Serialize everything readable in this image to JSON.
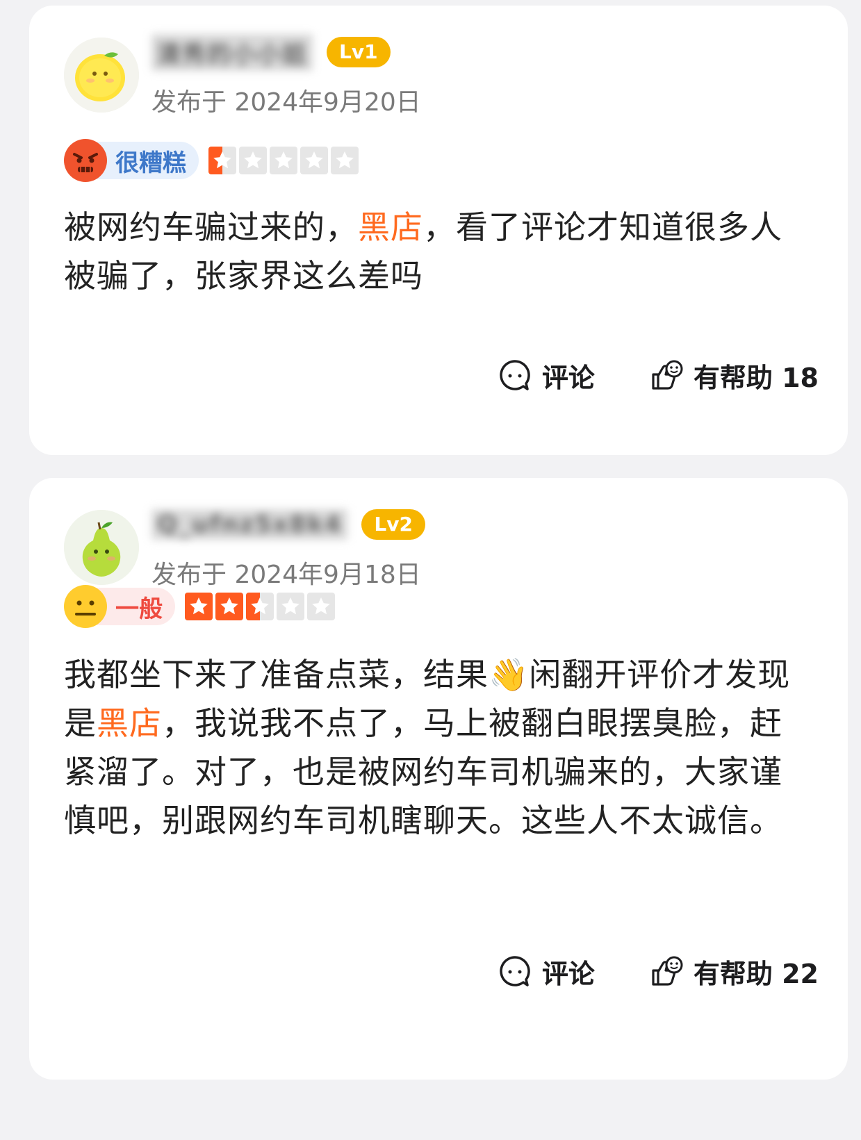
{
  "reviews": [
    {
      "username": "清秀的小小姐",
      "level": "Lv1",
      "avatar": "lemon-avatar",
      "date": "发布于 2024年9月20日",
      "rating_label": "很糟糕",
      "rating_face": "angry-face-icon",
      "stars": 0.5,
      "stars_max": 5,
      "text_parts": [
        "被网约车骗过来的，",
        "黑店",
        "，看了评论才知道很多人被骗了，张家界这么差吗"
      ],
      "comment_label": "评论",
      "helpful_label": "有帮助 18"
    },
    {
      "username": "Q_ufnz5x8k4",
      "level": "Lv2",
      "avatar": "pear-avatar",
      "date": "发布于 2024年9月18日",
      "rating_label": "一般",
      "rating_face": "neutral-face-icon",
      "stars": 2.5,
      "stars_max": 5,
      "text_parts": [
        "我都坐下来了准备点菜，结果👋闲翻开评价才发现是",
        "黑店",
        "，我说我不点了，马上被翻白眼摆臭脸，赶紧溜了。对了，也是被网约车司机骗来的，大家谨慎吧，别跟网约车司机瞎聊天。这些人不太诚信。"
      ],
      "comment_label": "评论",
      "helpful_label": "有帮助 22"
    }
  ],
  "colors": {
    "accent": "#ff6a1f",
    "level_badge": "#f7b500",
    "star_fill": "#ff5a1f",
    "star_empty": "#e6e6e6"
  }
}
